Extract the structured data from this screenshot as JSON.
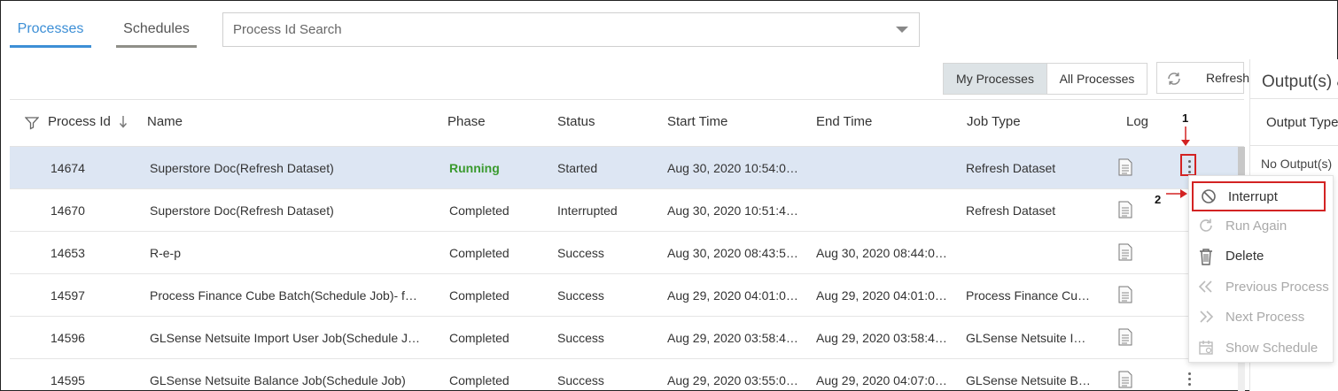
{
  "tabs": [
    {
      "label": "Processes",
      "active": true
    },
    {
      "label": "Schedules",
      "active": false
    }
  ],
  "search": {
    "placeholder": "Process Id Search",
    "value": ""
  },
  "filter_toggle": {
    "my": "My Processes",
    "all": "All Processes",
    "selected": "My Processes"
  },
  "refresh_label": "Refresh",
  "columns": [
    "Process Id",
    "Name",
    "Phase",
    "Status",
    "Start Time",
    "End Time",
    "Job Type",
    "Log"
  ],
  "rows": [
    {
      "id": "14674",
      "name": "Superstore Doc(Refresh Dataset)",
      "phase": "Running",
      "status": "Started",
      "start": "Aug 30, 2020 10:54:0…",
      "end": "",
      "job": "Refresh Dataset",
      "selected": true
    },
    {
      "id": "14670",
      "name": "Superstore Doc(Refresh Dataset)",
      "phase": "Completed",
      "status": "Interrupted",
      "start": "Aug 30, 2020 10:51:4…",
      "end": "",
      "job": "Refresh Dataset"
    },
    {
      "id": "14653",
      "name": "R-e-p",
      "phase": "Completed",
      "status": "Success",
      "start": "Aug 30, 2020 08:43:5…",
      "end": "Aug 30, 2020 08:44:0…",
      "job": ""
    },
    {
      "id": "14597",
      "name": "Process Finance Cube Batch(Schedule Job)- f…",
      "phase": "Completed",
      "status": "Success",
      "start": "Aug 29, 2020 04:01:0…",
      "end": "Aug 29, 2020 04:01:0…",
      "job": "Process Finance Cu…"
    },
    {
      "id": "14596",
      "name": "GLSense Netsuite Import User Job(Schedule J…",
      "phase": "Completed",
      "status": "Success",
      "start": "Aug 29, 2020 03:58:4…",
      "end": "Aug 29, 2020 03:58:4…",
      "job": "GLSense Netsuite I…"
    },
    {
      "id": "14595",
      "name": "GLSense Netsuite Balance Job(Schedule Job)",
      "phase": "Completed",
      "status": "Success",
      "start": "Aug 29, 2020 03:55:0…",
      "end": "Aug 29, 2020 04:07:0…",
      "job": "GLSense Netsuite B…"
    }
  ],
  "right_panel": {
    "title": "Output(s) &",
    "column": "Output Type",
    "empty": "No Output(s)"
  },
  "context_menu": [
    {
      "label": "Interrupt",
      "icon": "ban-icon",
      "enabled": true
    },
    {
      "label": "Run Again",
      "icon": "redo-icon",
      "enabled": false
    },
    {
      "label": "Delete",
      "icon": "trash-icon",
      "enabled": true
    },
    {
      "label": "Previous Process",
      "icon": "double-chevron-left-icon",
      "enabled": false
    },
    {
      "label": "Next Process",
      "icon": "double-chevron-right-icon",
      "enabled": false
    },
    {
      "label": "Show Schedule",
      "icon": "calendar-icon",
      "enabled": false
    }
  ],
  "annotations": [
    "1",
    "2"
  ],
  "colors": {
    "accent": "#3d8fd6",
    "running": "#3a9a2e",
    "selected_row": "#dde6f3",
    "annotation": "#d32323"
  }
}
